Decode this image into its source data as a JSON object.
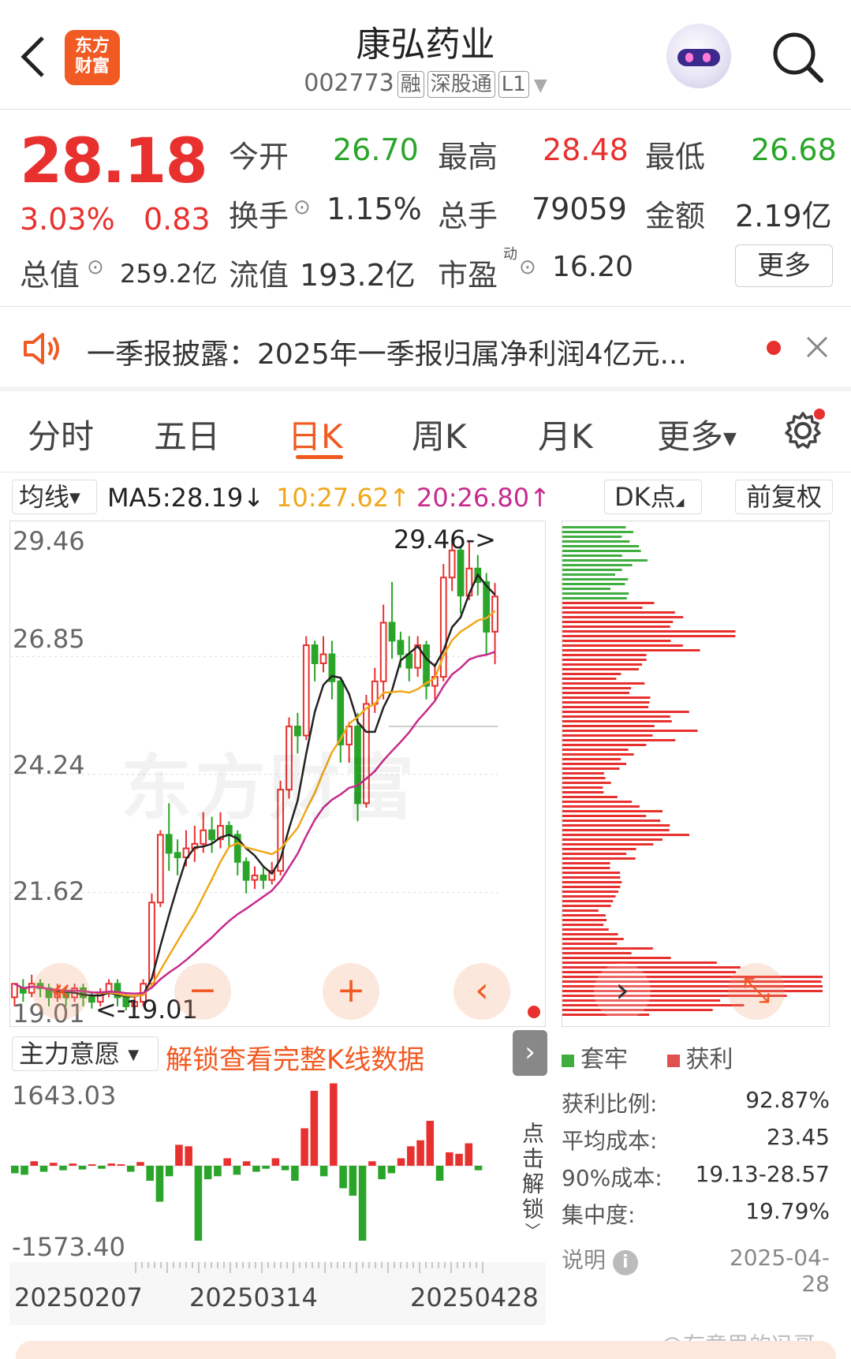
{
  "header": {
    "title": "康弘药业",
    "code": "002773",
    "tags": [
      "融",
      "深股通",
      "L1"
    ],
    "logo_text": "东方财富"
  },
  "quote": {
    "price": "28.18",
    "change_pct": "3.03%",
    "change": "0.83",
    "open_label": "今开",
    "open": "26.70",
    "high_label": "最高",
    "high": "28.48",
    "low_label": "最低",
    "low": "26.68",
    "turnover_label": "换手",
    "turnover": "1.15%",
    "volume_label": "总手",
    "volume": "79059",
    "amount_label": "金额",
    "amount": "2.19亿",
    "mktcap_label": "总值",
    "mktcap": "259.2亿",
    "float_label": "流值",
    "float": "193.2亿",
    "pe_label": "市盈",
    "pe_sup": "动",
    "pe": "16.20",
    "more": "更多"
  },
  "notice": {
    "text": "一季报披露：2025年一季报归属净利润4亿元..."
  },
  "tabs": [
    "分时",
    "五日",
    "日K",
    "周K",
    "月K",
    "更多"
  ],
  "active_tab": "日K",
  "chart_toolbar": {
    "ma_select": "均线",
    "ma5": "MA5:28.19↓",
    "ma10": "10:27.62↑",
    "ma20": "20:26.80↑",
    "dk": "DK点",
    "adjust": "前复权"
  },
  "chart_data": {
    "type": "candlestick",
    "y_ticks": [
      "29.46",
      "26.85",
      "24.24",
      "21.62",
      "19.01"
    ],
    "ylim": [
      19.01,
      29.46
    ],
    "high_marker": "29.46->",
    "low_marker": "<-19.01",
    "x_ticks": [
      "20250207",
      "20250314",
      "20250428"
    ],
    "candles": [
      [
        19.3,
        19.6,
        19.1,
        19.5
      ],
      [
        19.5,
        19.4,
        19.2,
        19.7
      ],
      [
        19.4,
        19.6,
        19.3,
        19.8
      ],
      [
        19.6,
        19.5,
        19.3,
        19.7
      ],
      [
        19.5,
        19.3,
        19.1,
        19.6
      ],
      [
        19.3,
        19.4,
        19.2,
        19.6
      ],
      [
        19.4,
        19.3,
        19.1,
        19.5
      ],
      [
        19.3,
        19.5,
        19.2,
        19.6
      ],
      [
        19.5,
        19.3,
        19.1,
        19.6
      ],
      [
        19.3,
        19.2,
        19.05,
        19.4
      ],
      [
        19.2,
        19.4,
        19.1,
        19.5
      ],
      [
        19.4,
        19.6,
        19.3,
        19.7
      ],
      [
        19.6,
        19.3,
        19.1,
        19.7
      ],
      [
        19.3,
        19.1,
        19.01,
        19.4
      ],
      [
        19.1,
        19.2,
        19.01,
        19.3
      ],
      [
        19.2,
        19.6,
        19.1,
        19.7
      ],
      [
        19.6,
        21.4,
        19.5,
        21.6
      ],
      [
        21.4,
        22.9,
        21.3,
        23.0
      ],
      [
        22.9,
        22.5,
        22.1,
        23.6
      ],
      [
        22.5,
        22.4,
        22.0,
        22.8
      ],
      [
        22.4,
        22.6,
        22.2,
        23.0
      ],
      [
        22.6,
        22.7,
        22.3,
        23.1
      ],
      [
        22.7,
        23.0,
        22.5,
        23.4
      ],
      [
        23.0,
        22.8,
        22.5,
        23.3
      ],
      [
        22.8,
        23.1,
        22.6,
        23.4
      ],
      [
        23.1,
        22.9,
        22.6,
        23.2
      ],
      [
        22.9,
        22.3,
        22.0,
        23.0
      ],
      [
        22.3,
        21.9,
        21.6,
        22.4
      ],
      [
        21.9,
        22.0,
        21.7,
        22.2
      ],
      [
        22.0,
        21.9,
        21.7,
        22.2
      ],
      [
        21.9,
        22.1,
        21.8,
        22.3
      ],
      [
        22.1,
        23.9,
        22.0,
        24.1
      ],
      [
        23.9,
        25.3,
        23.7,
        25.5
      ],
      [
        25.3,
        25.1,
        24.7,
        25.6
      ],
      [
        25.1,
        27.1,
        25.0,
        27.3
      ],
      [
        27.1,
        26.7,
        26.3,
        27.2
      ],
      [
        26.7,
        26.9,
        26.5,
        27.3
      ],
      [
        26.9,
        26.3,
        25.9,
        27.2
      ],
      [
        26.3,
        24.9,
        24.5,
        26.4
      ],
      [
        24.9,
        25.3,
        24.5,
        25.4
      ],
      [
        25.3,
        23.6,
        23.2,
        25.6
      ],
      [
        23.6,
        25.8,
        23.5,
        26.0
      ],
      [
        25.8,
        26.3,
        25.6,
        26.6
      ],
      [
        26.3,
        27.6,
        25.9,
        28.0
      ],
      [
        27.6,
        27.2,
        26.8,
        28.5
      ],
      [
        27.2,
        26.9,
        26.6,
        27.4
      ],
      [
        26.9,
        26.6,
        26.3,
        27.3
      ],
      [
        26.6,
        27.1,
        26.4,
        27.3
      ],
      [
        27.1,
        26.2,
        25.9,
        27.2
      ],
      [
        26.2,
        26.4,
        25.9,
        26.7
      ],
      [
        26.4,
        28.6,
        26.3,
        28.9
      ],
      [
        28.6,
        29.2,
        28.3,
        29.46
      ],
      [
        29.2,
        28.2,
        27.8,
        29.3
      ],
      [
        28.2,
        28.8,
        28.1,
        29.4
      ],
      [
        28.8,
        28.5,
        28.2,
        29.1
      ],
      [
        28.5,
        27.4,
        26.9,
        28.7
      ],
      [
        27.4,
        28.18,
        26.68,
        28.48
      ]
    ]
  },
  "chip": {
    "legend_trapped": "套牢",
    "legend_profit": "获利",
    "stats": [
      {
        "label": "获利比例:",
        "value": "92.87%"
      },
      {
        "label": "平均成本:",
        "value": "23.45"
      },
      {
        "label": "90%成本:",
        "value": "19.13-28.57"
      },
      {
        "label": "集中度:",
        "value": "19.79%"
      }
    ],
    "note_label": "说明",
    "date": "2025-04-28"
  },
  "subchart": {
    "select": "主力意愿",
    "unlock": "解锁查看完整K线数据",
    "max": "1643.03",
    "min": "-1573.40",
    "side": "点击解锁"
  },
  "watermark": "@有意思的冯哥",
  "colors": {
    "up": "#e8312f",
    "down": "#2aa52a",
    "accent": "#f15a22",
    "ma5": "#222222",
    "ma10": "#f0a81a",
    "ma20": "#c72b8e"
  }
}
